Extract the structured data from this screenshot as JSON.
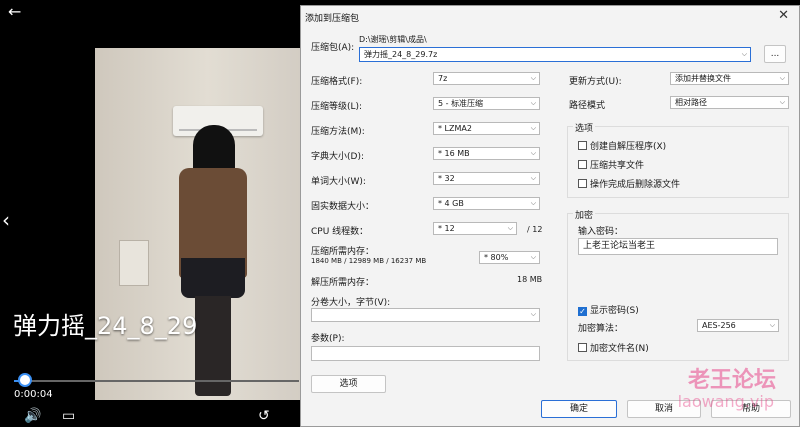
{
  "player": {
    "title": "弹力摇_24_8_29",
    "time": "0:00:04",
    "progress": 0.04,
    "accent": "#3b8ff2"
  },
  "dialog": {
    "title": "添加到压缩包",
    "archive_label": "压缩包(A):",
    "archive_path": "D:\\谢瑶\\剪辑\\成品\\",
    "archive_name": "弹力摇_24_8_29.7z",
    "browse_label": "...",
    "left_fields": [
      {
        "label": "压缩格式(F):",
        "value": "7z"
      },
      {
        "label": "压缩等级(L):",
        "value": "5 - 标准压缩"
      },
      {
        "label": "压缩方法(M):",
        "value": "* LZMA2"
      },
      {
        "label": "字典大小(D):",
        "value": "* 16 MB"
      },
      {
        "label": "单词大小(W):",
        "value": "* 32"
      },
      {
        "label": "固实数据大小：",
        "value": "* 4 GB"
      },
      {
        "label": "CPU 线程数：",
        "value": "* 12"
      }
    ],
    "cpu_total": "/ 12",
    "mem_label": "压缩所需内存：",
    "mem_detail": "1840 MB / 12989 MB / 16237 MB",
    "mem_percent": "* 80%",
    "decomp_label": "解压所需内存：",
    "decomp_value": "18 MB",
    "split_label": "分卷大小，字节(V):",
    "split_value": "",
    "params_label": "参数(P):",
    "params_value": "",
    "options_button": "选项",
    "update_label": "更新方式(U):",
    "update_value": "添加并替换文件",
    "path_label": "路径模式",
    "path_value": "相对路径",
    "options_group": "选项",
    "options": [
      {
        "label": "创建自解压程序(X)",
        "checked": false
      },
      {
        "label": "压缩共享文件",
        "checked": false
      },
      {
        "label": "操作完成后删除源文件",
        "checked": false
      }
    ],
    "encryption_group": "加密",
    "password_label": "输入密码：",
    "password_value": "上老王论坛当老王",
    "show_password_label": "显示密码(S)",
    "show_password_checked": true,
    "encryption_method_label": "加密算法：",
    "encryption_method_value": "AES-256",
    "encrypt_names_label": "加密文件名(N)",
    "encrypt_names_checked": false,
    "ok_label": "确定",
    "cancel_label": "取消",
    "help_label": "帮助"
  },
  "watermark": {
    "line1": "老王论坛",
    "line2": "laowang.vip",
    "color": "#e8488a"
  }
}
